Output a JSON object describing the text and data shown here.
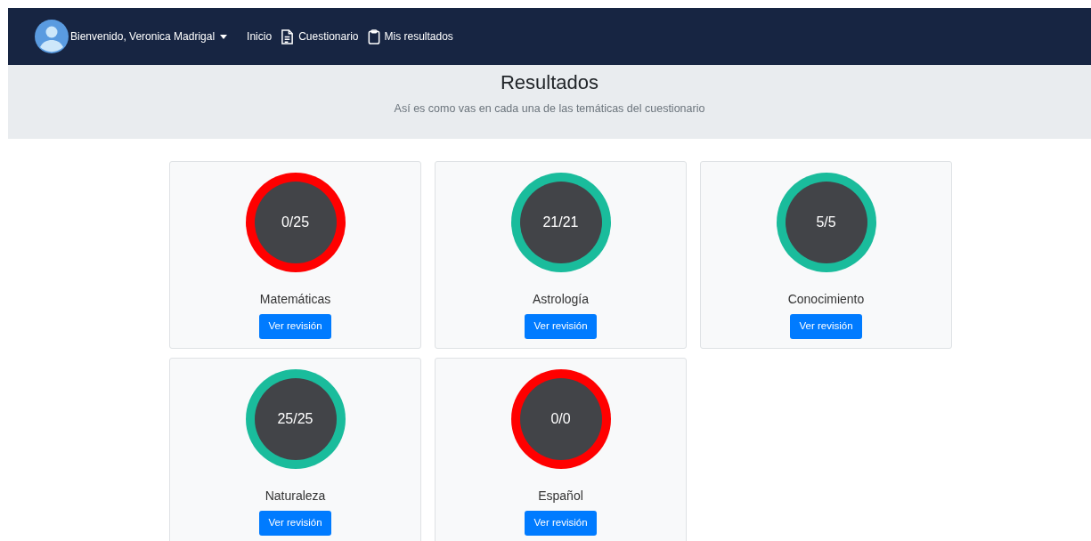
{
  "navbar": {
    "user_menu": "Bienvenido, Veronica Madrigal",
    "links": [
      {
        "label": "Inicio",
        "kind": "plain"
      },
      {
        "label": "Cuestionario",
        "kind": "document"
      },
      {
        "label": "Mis resultados",
        "kind": "clipboard"
      }
    ]
  },
  "header": {
    "title": "Resultados",
    "subtitle": "Así es como vas en cada una de las temáticas del cuestionario"
  },
  "results": [
    {
      "score": "0/25",
      "topic": "Matemáticas",
      "color": "#ff0000",
      "button": "Ver revisión"
    },
    {
      "score": "21/21",
      "topic": "Astrología",
      "color": "#1abc9c",
      "button": "Ver revisión"
    },
    {
      "score": "5/5",
      "topic": "Conocimiento",
      "color": "#1abc9c",
      "button": "Ver revisión"
    },
    {
      "score": "25/25",
      "topic": "Naturaleza",
      "color": "#1abc9c",
      "button": "Ver revisión"
    },
    {
      "score": "0/0",
      "topic": "Español",
      "color": "#ff0000",
      "button": "Ver revisión"
    }
  ]
}
